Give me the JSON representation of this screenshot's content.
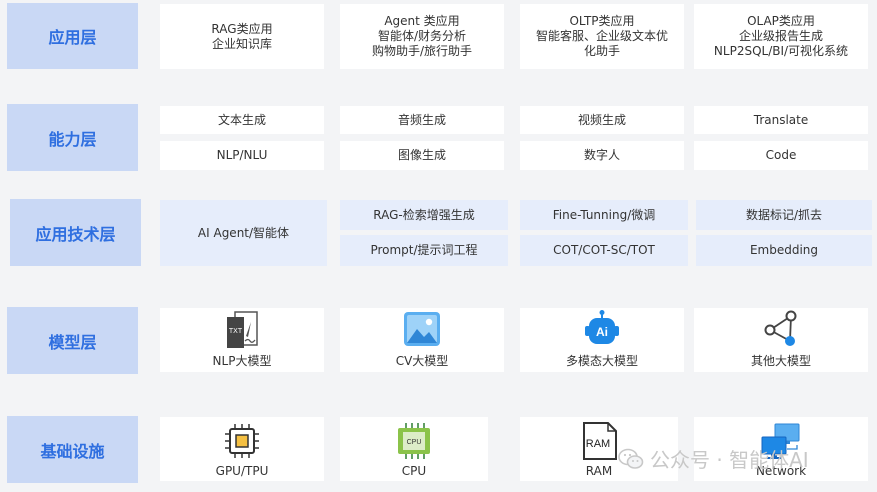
{
  "layers": {
    "app": "应用层",
    "capability": "能力层",
    "tech": "应用技术层",
    "model": "模型层",
    "infra": "基础设施"
  },
  "app_row": [
    {
      "lines": [
        "RAG类应用",
        "企业知识库"
      ]
    },
    {
      "lines": [
        "Agent 类应用",
        "智能体/财务分析",
        "购物助手/旅行助手"
      ]
    },
    {
      "lines": [
        "OLTP类应用",
        "智能客服、企业级文本优",
        "化助手"
      ]
    },
    {
      "lines": [
        "OLAP类应用",
        "企业级报告生成",
        "NLP2SQL/BI/可视化系统"
      ]
    }
  ],
  "capability_row1": [
    "文本生成",
    "音频生成",
    "视频生成",
    "Translate"
  ],
  "capability_row2": [
    "NLP/NLU",
    "图像生成",
    "数字人",
    "Code"
  ],
  "tech": {
    "agent": "AI Agent/智能体",
    "row1": [
      "RAG-检索增强生成",
      "Fine-Tunning/微调",
      "数据标记/抓去"
    ],
    "row2": [
      "Prompt/提示词工程",
      "COT/COT-SC/TOT",
      "Embedding"
    ]
  },
  "models": [
    {
      "label": "NLP大模型",
      "icon": "txt-document-icon",
      "icon_text": "TXT"
    },
    {
      "label": "CV大模型",
      "icon": "image-icon"
    },
    {
      "label": "多模态大模型",
      "icon": "ai-robot-icon",
      "icon_text": "Ai"
    },
    {
      "label": "其他大模型",
      "icon": "network-nodes-icon"
    }
  ],
  "infra": [
    {
      "label": "GPU/TPU",
      "icon": "chip-icon"
    },
    {
      "label": "CPU",
      "icon": "cpu-icon",
      "icon_text": "CPU"
    },
    {
      "label": "RAM",
      "icon": "ram-icon",
      "icon_text": "RAM"
    },
    {
      "label": "Network",
      "icon": "computers-icon"
    }
  ],
  "watermark": "公众号 · 智能体AI",
  "colors": {
    "layer_bg": "#c9d8f5",
    "layer_text": "#2f6fe0",
    "tech_bg": "#e6edfb",
    "accent": "#1e88e5"
  }
}
